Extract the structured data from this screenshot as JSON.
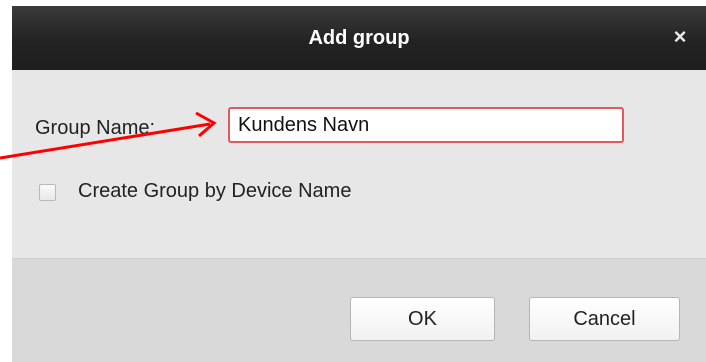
{
  "dialog": {
    "title": "Add group",
    "close_icon": "close-icon",
    "close_glyph": "×",
    "group_name_label": "Group Name:",
    "group_name_value": "Kundens Navn",
    "create_by_device_label": "Create Group by Device Name",
    "create_by_device_checked": false,
    "ok_label": "OK",
    "cancel_label": "Cancel"
  },
  "annotation": {
    "arrow_color": "#ff0000"
  }
}
